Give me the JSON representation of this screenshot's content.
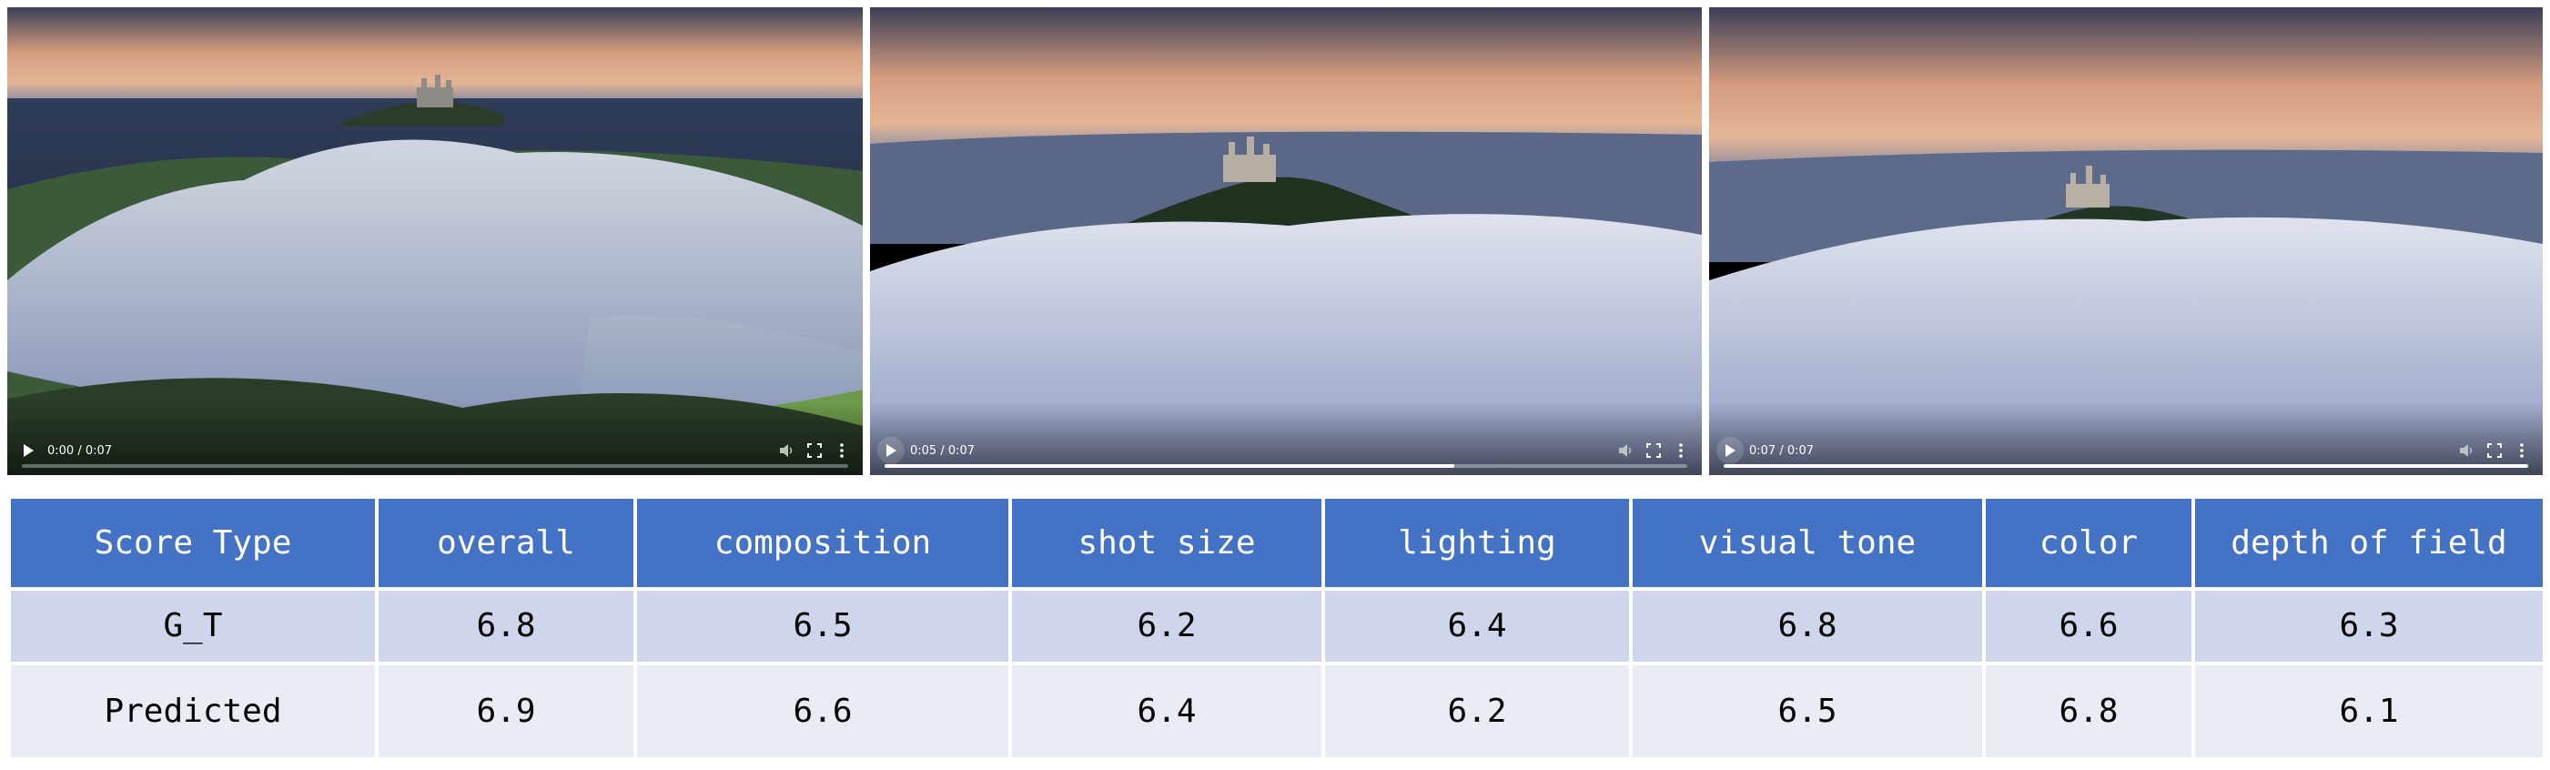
{
  "players": [
    {
      "name": "player-1",
      "time": "0:00 / 0:07",
      "progress": 0.0
    },
    {
      "name": "player-2",
      "time": "0:05 / 0:07",
      "progress": 0.71
    },
    {
      "name": "player-3",
      "time": "0:07 / 0:07",
      "progress": 1.0
    }
  ],
  "table": {
    "header": [
      "Score Type",
      "overall",
      "composition",
      "shot size",
      "lighting",
      "visual tone",
      "color",
      "depth of field"
    ],
    "rows": [
      [
        "G_T",
        "6.8",
        "6.5",
        "6.2",
        "6.4",
        "6.8",
        "6.6",
        "6.3"
      ],
      [
        "Predicted",
        "6.9",
        "6.6",
        "6.4",
        "6.2",
        "6.5",
        "6.8",
        "6.1"
      ]
    ]
  },
  "icons": {
    "play": "play-icon",
    "volume": "volume-icon",
    "fullscreen": "fullscreen-icon",
    "more": "more-vert-icon"
  },
  "colors": {
    "header_bg": "#4472c4",
    "row1_bg": "#cfd5ea",
    "row2_bg": "#e9ebf5"
  }
}
